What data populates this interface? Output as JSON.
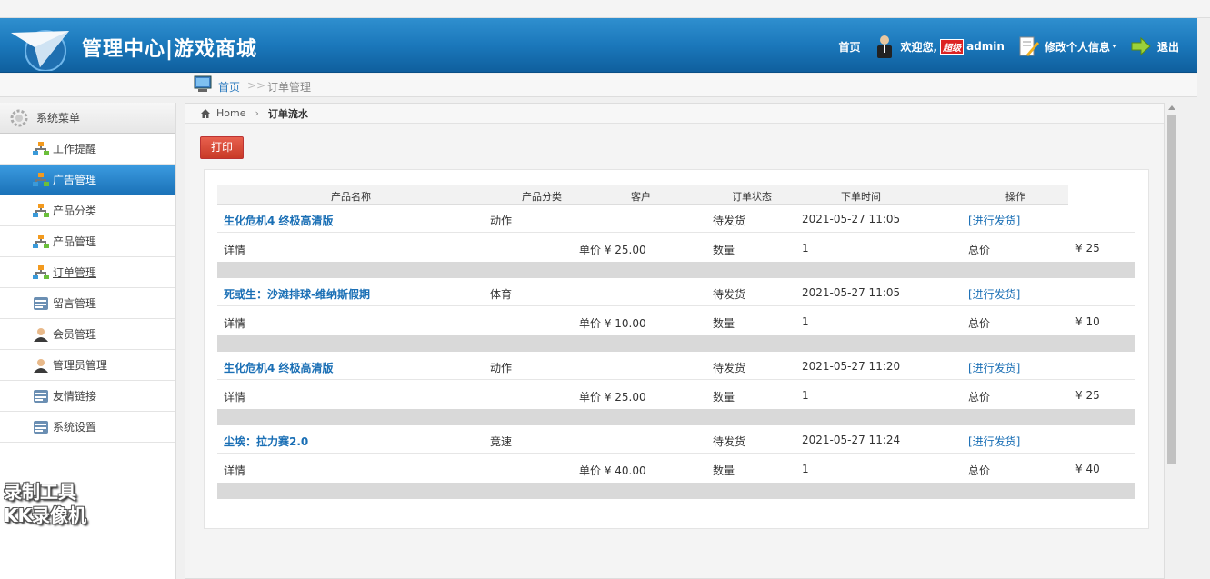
{
  "header": {
    "title": "管理中心|游戏商城",
    "home": "首页",
    "welcome": "欢迎您,",
    "role_badge": "超级",
    "username": "admin",
    "edit_profile": "修改个人信息",
    "logout": "退出"
  },
  "breadcrumb_top": {
    "home": "首页",
    "sep": ">>",
    "current": "订单管理"
  },
  "sidebar": {
    "title": "系统菜单",
    "items": [
      {
        "label": "工作提醒",
        "icon": "tree-icon"
      },
      {
        "label": "广告管理",
        "icon": "tree-icon"
      },
      {
        "label": "产品分类",
        "icon": "tree-icon"
      },
      {
        "label": "产品管理",
        "icon": "tree-icon"
      },
      {
        "label": "订单管理",
        "icon": "tree-icon"
      },
      {
        "label": "留言管理",
        "icon": "list-icon"
      },
      {
        "label": "会员管理",
        "icon": "user-icon"
      },
      {
        "label": "管理员管理",
        "icon": "user-icon"
      },
      {
        "label": "友情链接",
        "icon": "list-icon"
      },
      {
        "label": "系统设置",
        "icon": "list-icon"
      }
    ]
  },
  "watermark": {
    "line1": "录制工具",
    "line2": "KK录像机"
  },
  "content": {
    "crumb_home": "Home",
    "crumb_current": "订单流水",
    "print": "打印",
    "columns": [
      "产品名称",
      "产品分类",
      "客户",
      "订单状态",
      "下单时间",
      "操作"
    ],
    "orders": [
      {
        "name": "生化危机4 终极高清版",
        "category": "动作",
        "status": "待发货",
        "time": "2021-05-27 11:05",
        "action": "[进行发货]",
        "detail": "详情",
        "unit_price": "单价 ¥ 25.00",
        "qty_label": "数量",
        "qty": "1",
        "total_label": "总价",
        "total": "¥ 25"
      },
      {
        "name": "死或生：沙滩排球-维纳斯假期",
        "category": "体育",
        "status": "待发货",
        "time": "2021-05-27 11:05",
        "action": "[进行发货]",
        "detail": "详情",
        "unit_price": "单价 ¥ 10.00",
        "qty_label": "数量",
        "qty": "1",
        "total_label": "总价",
        "total": "¥ 10"
      },
      {
        "name": "生化危机4 终极高清版",
        "category": "动作",
        "status": "待发货",
        "time": "2021-05-27 11:20",
        "action": "[进行发货]",
        "detail": "详情",
        "unit_price": "单价 ¥ 25.00",
        "qty_label": "数量",
        "qty": "1",
        "total_label": "总价",
        "total": "¥ 25"
      },
      {
        "name": "尘埃：拉力赛2.0",
        "category": "竞速",
        "status": "待发货",
        "time": "2021-05-27 11:24",
        "action": "[进行发货]",
        "detail": "详情",
        "unit_price": "单价 ¥ 40.00",
        "qty_label": "数量",
        "qty": "1",
        "total_label": "总价",
        "total": "¥ 40"
      }
    ]
  }
}
